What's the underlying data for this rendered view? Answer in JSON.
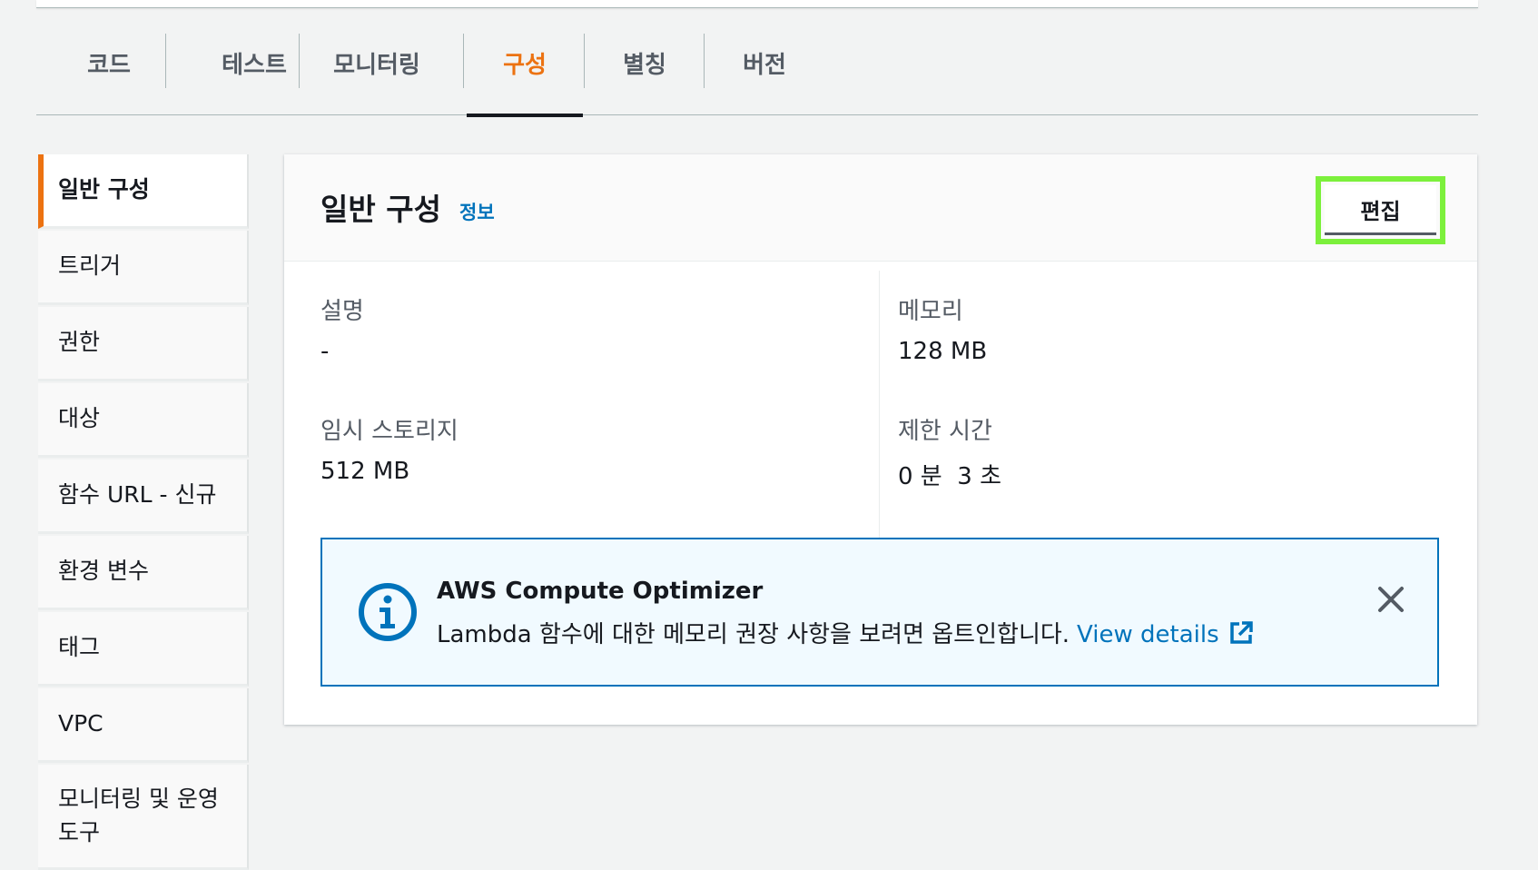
{
  "tabs": {
    "code": "코드",
    "test": "테스트",
    "monitoring": "모니터링",
    "configuration": "구성",
    "aliases": "별칭",
    "versions": "버전"
  },
  "sidenav": {
    "general": "일반 구성",
    "triggers": "트리거",
    "permissions": "권한",
    "destinations": "대상",
    "function_url": "함수 URL - 신규",
    "env_vars": "환경 변수",
    "tags": "태그",
    "vpc": "VPC",
    "monitoring_tools_line1": "모니터링 및 운영",
    "monitoring_tools_line2": "도구"
  },
  "panel": {
    "title": "일반 구성",
    "info": "정보",
    "edit": "편집"
  },
  "fields": {
    "description_label": "설명",
    "description_value": "-",
    "memory_label": "메모리",
    "memory_value": "128 MB",
    "ephemeral_label": "임시 스토리지",
    "ephemeral_value": "512 MB",
    "timeout_label": "제한 시간",
    "timeout_value": "0 분  3 초"
  },
  "alert": {
    "title": "AWS Compute Optimizer",
    "body": "Lambda 함수에 대한 메모리 권장 사항을 보려면 옵트인합니다.",
    "link": "View details",
    "icon": "info-icon",
    "link_icon": "external-link-icon",
    "close_icon": "close-icon"
  },
  "colors": {
    "accent": "#ec7211",
    "link": "#0073bb",
    "highlight": "#7cf03c"
  }
}
